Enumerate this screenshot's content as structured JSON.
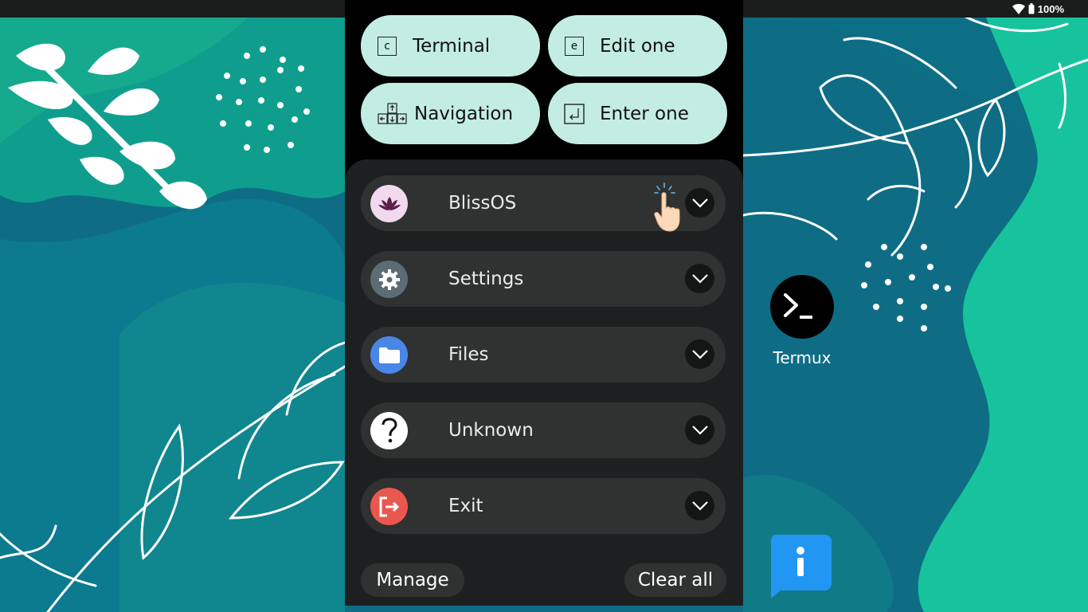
{
  "status_bar": {
    "battery": "100%",
    "icons": [
      "wifi-icon",
      "battery-icon"
    ]
  },
  "shortcuts": [
    {
      "label": "Terminal",
      "key": "c",
      "icon": "keycap-c-icon"
    },
    {
      "label": "Edit one",
      "key": "e",
      "icon": "keycap-e-icon"
    },
    {
      "label": "Navigation",
      "icon": "arrow-keys-icon"
    },
    {
      "label": "Enter one",
      "icon": "enter-key-icon"
    }
  ],
  "apps": [
    {
      "label": "BlissOS",
      "icon": "blissos-lotus-icon",
      "color": "#f1d9ee"
    },
    {
      "label": "Settings",
      "icon": "gear-icon",
      "color": "#5c6c74"
    },
    {
      "label": "Files",
      "icon": "folder-icon",
      "color": "#4a86e8"
    },
    {
      "label": "Unknown",
      "icon": "question-icon",
      "color": "#ffffff"
    },
    {
      "label": "Exit",
      "icon": "exit-icon",
      "color": "#e9574f"
    }
  ],
  "footer": {
    "manage": "Manage",
    "clear_all": "Clear all"
  },
  "desktop": {
    "termux_label": "Termux",
    "info_icon": "info-icon"
  },
  "colors": {
    "shortcut_bg": "#c3ede2",
    "row_bg": "#2f3231",
    "sheet_bg": "#1d2020",
    "wallpaper_teal": "#14b28f",
    "wallpaper_blue": "#0d6f86"
  }
}
